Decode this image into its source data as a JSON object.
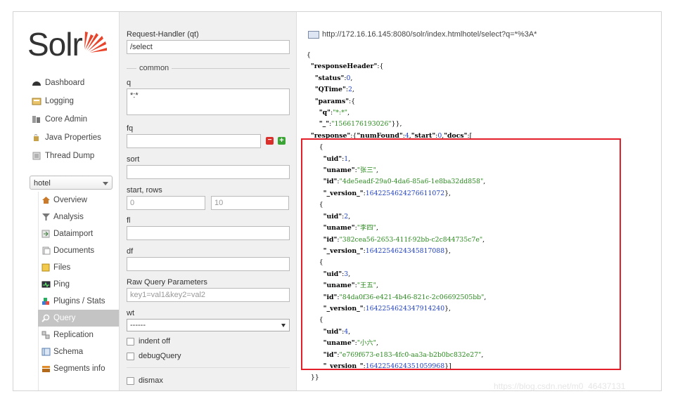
{
  "sidebar": {
    "logo_text": "Solr",
    "nav": [
      {
        "label": "Dashboard",
        "icon": "dashboard-icon"
      },
      {
        "label": "Logging",
        "icon": "logging-icon"
      },
      {
        "label": "Core Admin",
        "icon": "core-admin-icon"
      },
      {
        "label": "Java Properties",
        "icon": "java-properties-icon"
      },
      {
        "label": "Thread Dump",
        "icon": "thread-dump-icon"
      }
    ],
    "core_selected": "hotel",
    "core_menu": [
      {
        "label": "Overview",
        "icon": "overview-icon"
      },
      {
        "label": "Analysis",
        "icon": "analysis-icon"
      },
      {
        "label": "Dataimport",
        "icon": "dataimport-icon"
      },
      {
        "label": "Documents",
        "icon": "documents-icon"
      },
      {
        "label": "Files",
        "icon": "files-icon"
      },
      {
        "label": "Ping",
        "icon": "ping-icon"
      },
      {
        "label": "Plugins / Stats",
        "icon": "plugins-icon"
      },
      {
        "label": "Query",
        "icon": "query-icon"
      },
      {
        "label": "Replication",
        "icon": "replication-icon"
      },
      {
        "label": "Schema",
        "icon": "schema-icon"
      },
      {
        "label": "Segments info",
        "icon": "segments-icon"
      }
    ]
  },
  "form": {
    "request_handler_label": "Request-Handler (qt)",
    "request_handler_value": "/select",
    "common_legend": "common",
    "q_label": "q",
    "q_value": "*:*",
    "fq_label": "fq",
    "fq_value": "",
    "sort_label": "sort",
    "start_rows_label": "start, rows",
    "start_value": "0",
    "rows_value": "10",
    "fl_label": "fl",
    "df_label": "df",
    "raw_label": "Raw Query Parameters",
    "raw_placeholder": "key1=val1&key2=val2",
    "wt_label": "wt",
    "wt_value": "------",
    "indent_label": "indent off",
    "debug_label": "debugQuery",
    "dismax_label": "dismax"
  },
  "result": {
    "url": "http://172.16.16.145:8080/solr/index.htmlhotel/select?q=*%3A*",
    "docs": [
      {
        "uid": "1",
        "uname": "张三",
        "id": "4de5eadf-29a0-4da6-85a6-1e8ba32dd858",
        "version": "1642254624276611072"
      },
      {
        "uid": "2",
        "uname": "李四",
        "id": "382cea56-2653-411f-92bb-c2c844735c7e",
        "version": "1642254624345817088"
      },
      {
        "uid": "3",
        "uname": "王五",
        "id": "84da0f36-e421-4b46-821c-2c06692505bb",
        "version": "1642254624347914240"
      },
      {
        "uid": "4",
        "uname": "小六",
        "id": "e769f673-e183-4fc0-aa3a-b2b0bc832e27",
        "version": "1642254624351059968"
      }
    ],
    "status": "0",
    "qtime": "2",
    "q": "*:*",
    "underscore": "1566176193026",
    "num_found": "4",
    "start": "0"
  },
  "watermark": "https://blog.csdn.net/m0_46437131",
  "colors": {
    "highlight_border": "#e3202a",
    "string": "#2a8a1e",
    "number": "#1f3fbf",
    "active_menu": "#c4c4c4"
  }
}
